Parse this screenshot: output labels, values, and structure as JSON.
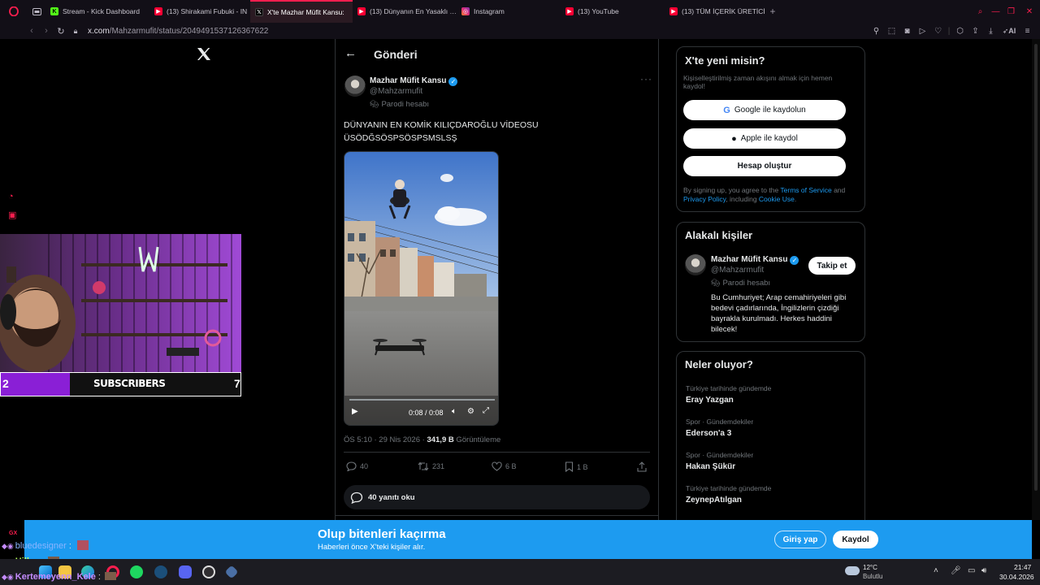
{
  "browser": {
    "tabs": [
      {
        "label": "Stream - Kick Dashboard",
        "color": "#53fc18"
      },
      {
        "label": "(13) Shirakami Fubuki - IN",
        "color": "#ff0033"
      },
      {
        "label": "X'te Mazhar Müfit Kansu:",
        "color": "#ffffff"
      },
      {
        "label": "(13) Dünyanın En Yasaklı …",
        "color": "#ff0033"
      },
      {
        "label": "Instagram",
        "color": "#e1306c"
      },
      {
        "label": "(13) YouTube",
        "color": "#ff0033"
      },
      {
        "label": "(13) TÜM İÇERİK ÜRETİCİ",
        "color": "#ff0033"
      }
    ],
    "new_tab": "+",
    "url_host": "x.com",
    "url_path": "/Mahzarmufit/status/2049491537126367622",
    "ai_label": "AI"
  },
  "post": {
    "header_title": "Gönderi",
    "author_name": "Mazhar Müfit Kansu",
    "author_handle": "@Mahzarmufit",
    "parody": "Parodi hesabı",
    "text_line1": "DÜNYANIN EN KOMİK KILIÇDAROĞLU VİDEOSU",
    "text_line2": "ÜSÖDĞSÖSPSÖSPSMSLSŞ",
    "video_time": "0:08 / 0:08",
    "timestamp": "ÖS 5:10 · 29 Nis 2026 · ",
    "views_count": "341,9 B",
    "views_label": " Görüntüleme",
    "replies": "40",
    "reposts": "231",
    "likes": "6 B",
    "bookmarks": "1 B",
    "read_replies": "40 yanıtı oku"
  },
  "signup": {
    "title": "X'te yeni misin?",
    "subtitle": "Kişiselleştirilmiş zaman akışını almak için hemen kaydol!",
    "google": "Google ile kaydolun",
    "apple": "Apple ile kaydol",
    "create": "Hesap oluştur",
    "legal_pre": "By signing up, you agree to the ",
    "tos": "Terms of Service",
    "legal_and": " and ",
    "privacy": "Privacy Policy",
    "legal_incl": ", including ",
    "cookie": "Cookie Use",
    "legal_end": "."
  },
  "related": {
    "title": "Alakalı kişiler",
    "name": "Mazhar Müfit Kansu",
    "handle": "@Mahzarmufit",
    "parody": "Parodi hesabı",
    "follow": "Takip et",
    "bio": "Bu Cumhuriyet; Arap cemahiriyeleri gibi bedevi çadırlarında, İngilizlerin çizdiği bayrakla kurulmadı. Herkes haddini bilecek!"
  },
  "trends": {
    "title": "Neler oluyor?",
    "items": [
      {
        "context": "Türkiye tarihinde gündemde",
        "topic": "Eray Yazgan"
      },
      {
        "context": "Spor · Gündemdekiler",
        "topic": "Ederson'a 3"
      },
      {
        "context": "Spor · Gündemdekiler",
        "topic": "Hakan Şükür"
      },
      {
        "context": "Türkiye tarihinde gündemde",
        "topic": "ZeynepAtılgan"
      }
    ]
  },
  "banner": {
    "title": "Olup bitenleri kaçırma",
    "subtitle": "Haberleri önce X'teki kişiler alır.",
    "login": "Giriş yap",
    "signup": "Kaydol"
  },
  "overlay": {
    "sub_left": "2",
    "sub_label": "SUBSCRIBERS",
    "sub_right": "7",
    "gx": "GX",
    "chat": [
      {
        "user": "bluedesigner",
        "sep": " :",
        "color": "#8ab4ff"
      },
      {
        "user": "Hillya",
        "sep": " :",
        "color": "#b6ff5c"
      },
      {
        "user": "Kertemeyenn_Kele",
        "sep": " :",
        "color": "#c58cff"
      }
    ]
  },
  "taskbar": {
    "temp": "12°C",
    "weather": "Bulutlu",
    "time": "21:47",
    "date": "30.04.2026"
  },
  "colors": {
    "accent": "#1d9bf0",
    "opera": "#fa1e4e",
    "purple": "#8a1fd6"
  }
}
